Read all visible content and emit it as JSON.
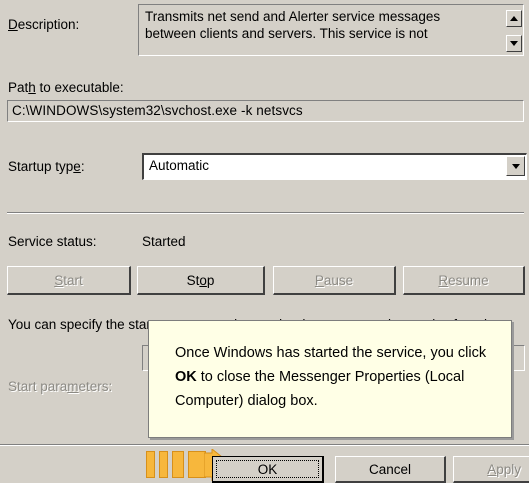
{
  "description": {
    "label_pre": "",
    "label_accel": "D",
    "label_post": "escription:",
    "text": "Transmits net send and Alerter service messages between clients and servers. This service is not"
  },
  "path": {
    "label_pre": "Pat",
    "label_accel": "h",
    "label_post": " to executable:",
    "value": "C:\\WINDOWS\\system32\\svchost.exe -k netsvcs"
  },
  "startup": {
    "label_pre": "Startup typ",
    "label_accel": "e",
    "label_post": ":",
    "value": "Automatic"
  },
  "status": {
    "label": "Service status:",
    "value": "Started"
  },
  "service_buttons": {
    "start_accel": "S",
    "start_post": "tart",
    "stop_pre": "St",
    "stop_accel": "o",
    "stop_post": "p",
    "pause_accel": "P",
    "pause_post": "ause",
    "resume_accel": "R",
    "resume_post": "esume"
  },
  "hint_text": "You can specify the start parameters that apply when you start the service from here.",
  "params": {
    "label_pre": "Start para",
    "label_accel": "m",
    "label_post": "eters:"
  },
  "callout": {
    "pre": "Once Windows has started the service, you click ",
    "bold": "OK",
    "post": " to close the Messenger Properties (Local Computer) dialog box."
  },
  "dialog_buttons": {
    "ok": "OK",
    "cancel": "Cancel",
    "apply_accel": "A",
    "apply_post": "pply"
  },
  "colors": {
    "arrow": "#f7b73c",
    "callout_bg": "#ffffe6",
    "dialog_bg": "#d4d0c8"
  }
}
